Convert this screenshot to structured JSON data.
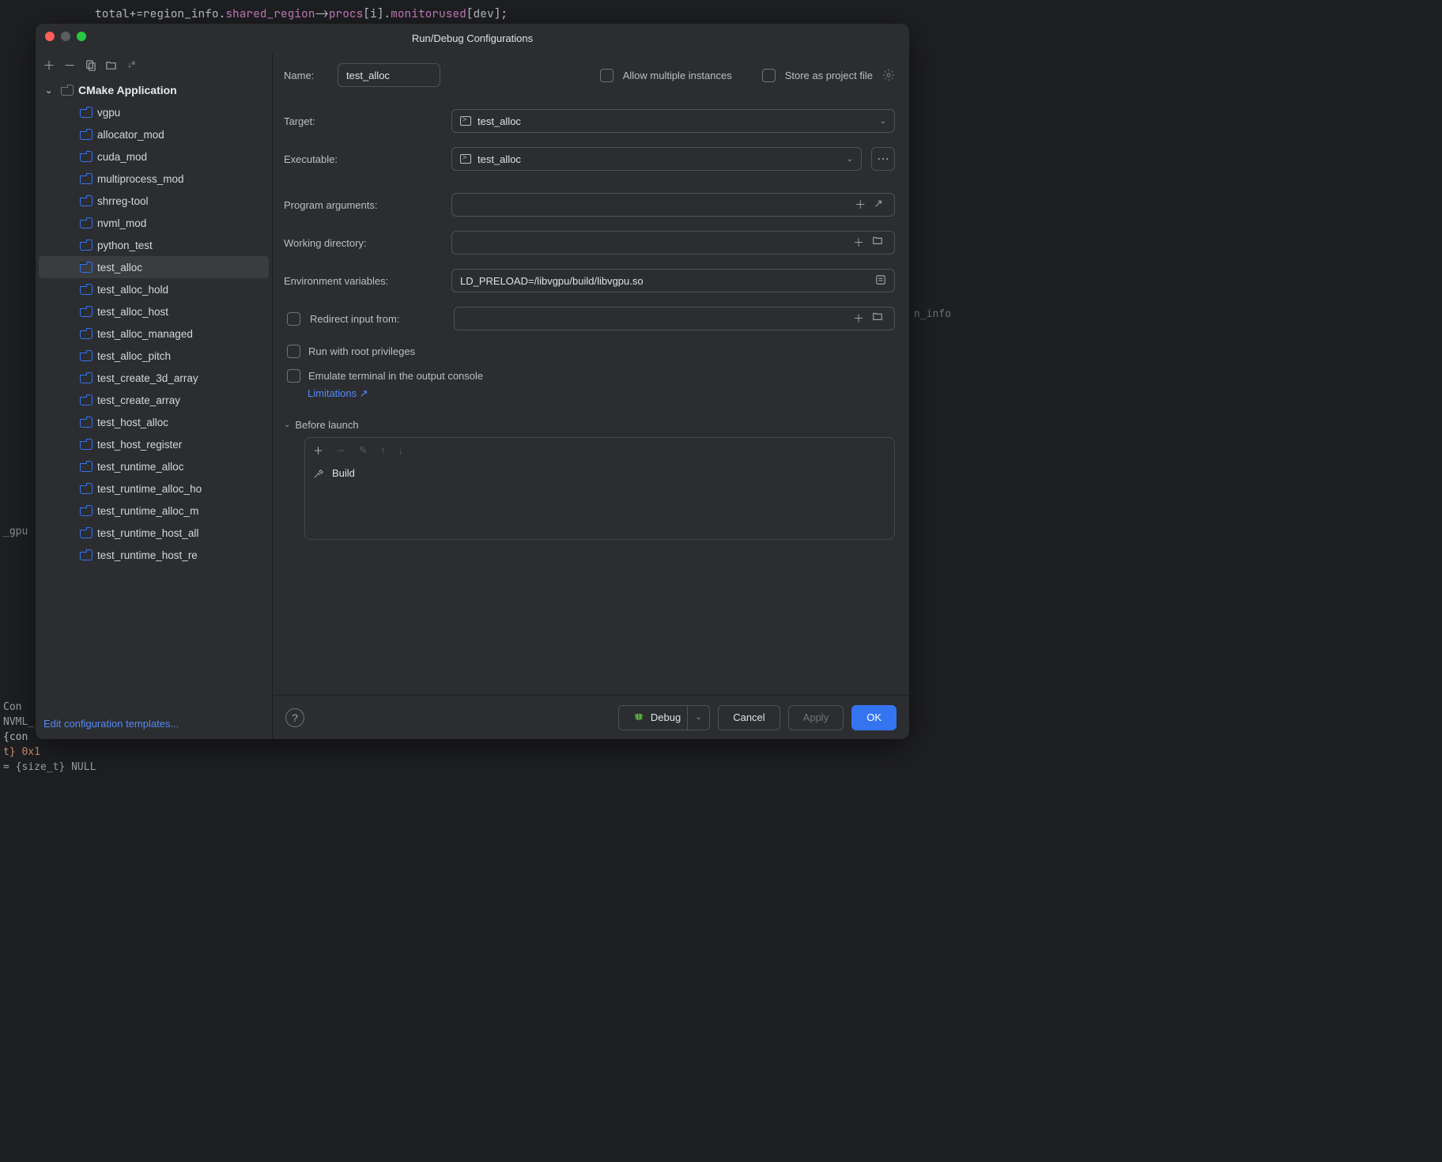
{
  "code_line": "total+=region_info.shared_region->procs[i].monitorused[dev];",
  "dialog_title": "Run/Debug Configurations",
  "tree": {
    "root": "CMake Application",
    "items": [
      "vgpu",
      "allocator_mod",
      "cuda_mod",
      "multiprocess_mod",
      "shrreg-tool",
      "nvml_mod",
      "python_test",
      "test_alloc",
      "test_alloc_hold",
      "test_alloc_host",
      "test_alloc_managed",
      "test_alloc_pitch",
      "test_create_3d_array",
      "test_create_array",
      "test_host_alloc",
      "test_host_register",
      "test_runtime_alloc",
      "test_runtime_alloc_ho",
      "test_runtime_alloc_m",
      "test_runtime_host_all",
      "test_runtime_host_re"
    ],
    "selected_index": 7
  },
  "edit_templates": "Edit configuration templates...",
  "form": {
    "name_label": "Name:",
    "name_value": "test_alloc",
    "allow_multiple": "Allow multiple instances",
    "store_project": "Store as project file",
    "target_label": "Target:",
    "target_value": "test_alloc",
    "exe_label": "Executable:",
    "exe_value": "test_alloc",
    "args_label": "Program arguments:",
    "wd_label": "Working directory:",
    "env_label": "Environment variables:",
    "env_value": "LD_PRELOAD=/libvgpu/build/libvgpu.so",
    "redirect_label": "Redirect input from:",
    "root_priv": "Run with root privileges",
    "emulate": "Emulate terminal in the output console",
    "limitations": "Limitations ↗",
    "before_section": "Before launch",
    "build_item": "Build"
  },
  "footer": {
    "debug": "Debug",
    "cancel": "Cancel",
    "apply": "Apply",
    "ok": "OK"
  },
  "bg_bottom": {
    "l1": " Con",
    "l2": "NVML_",
    "l3": " {con",
    "l4": "t} 0x1",
    "l5": "= {size_t} NULL"
  },
  "bg_right": "n_info",
  "bg_gpu": "_gpu"
}
